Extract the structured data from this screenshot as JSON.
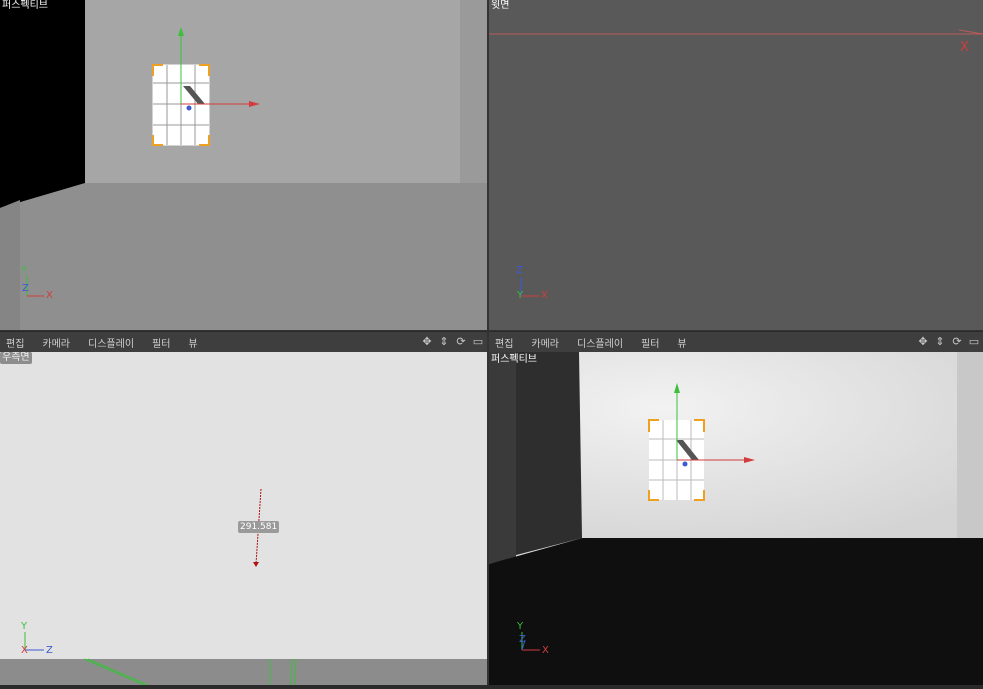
{
  "viewports": {
    "top_left": {
      "label": "퍼스펙티브"
    },
    "top_right": {
      "label": "윗면"
    },
    "bottom_left": {
      "label": "우측면",
      "dimension": "291.581"
    },
    "bottom_right": {
      "label": "퍼스펙티브"
    }
  },
  "menubar_left": {
    "items": [
      "편집",
      "카메라",
      "디스플레이",
      "필터",
      "뷰"
    ]
  },
  "menubar_right": {
    "items": [
      "편집",
      "카메라",
      "디스플레이",
      "필터",
      "뷰"
    ]
  },
  "axis_labels": {
    "x": "X",
    "y": "Y",
    "z": "Z"
  },
  "icons": [
    "move-view-icon",
    "zoom-view-icon",
    "rotate-view-icon",
    "maximize-view-icon"
  ],
  "colors": {
    "axis_x": "#d23c3c",
    "axis_y": "#3cbf3c",
    "axis_z": "#3c5ad2",
    "selection_corner": "#f0a020"
  }
}
